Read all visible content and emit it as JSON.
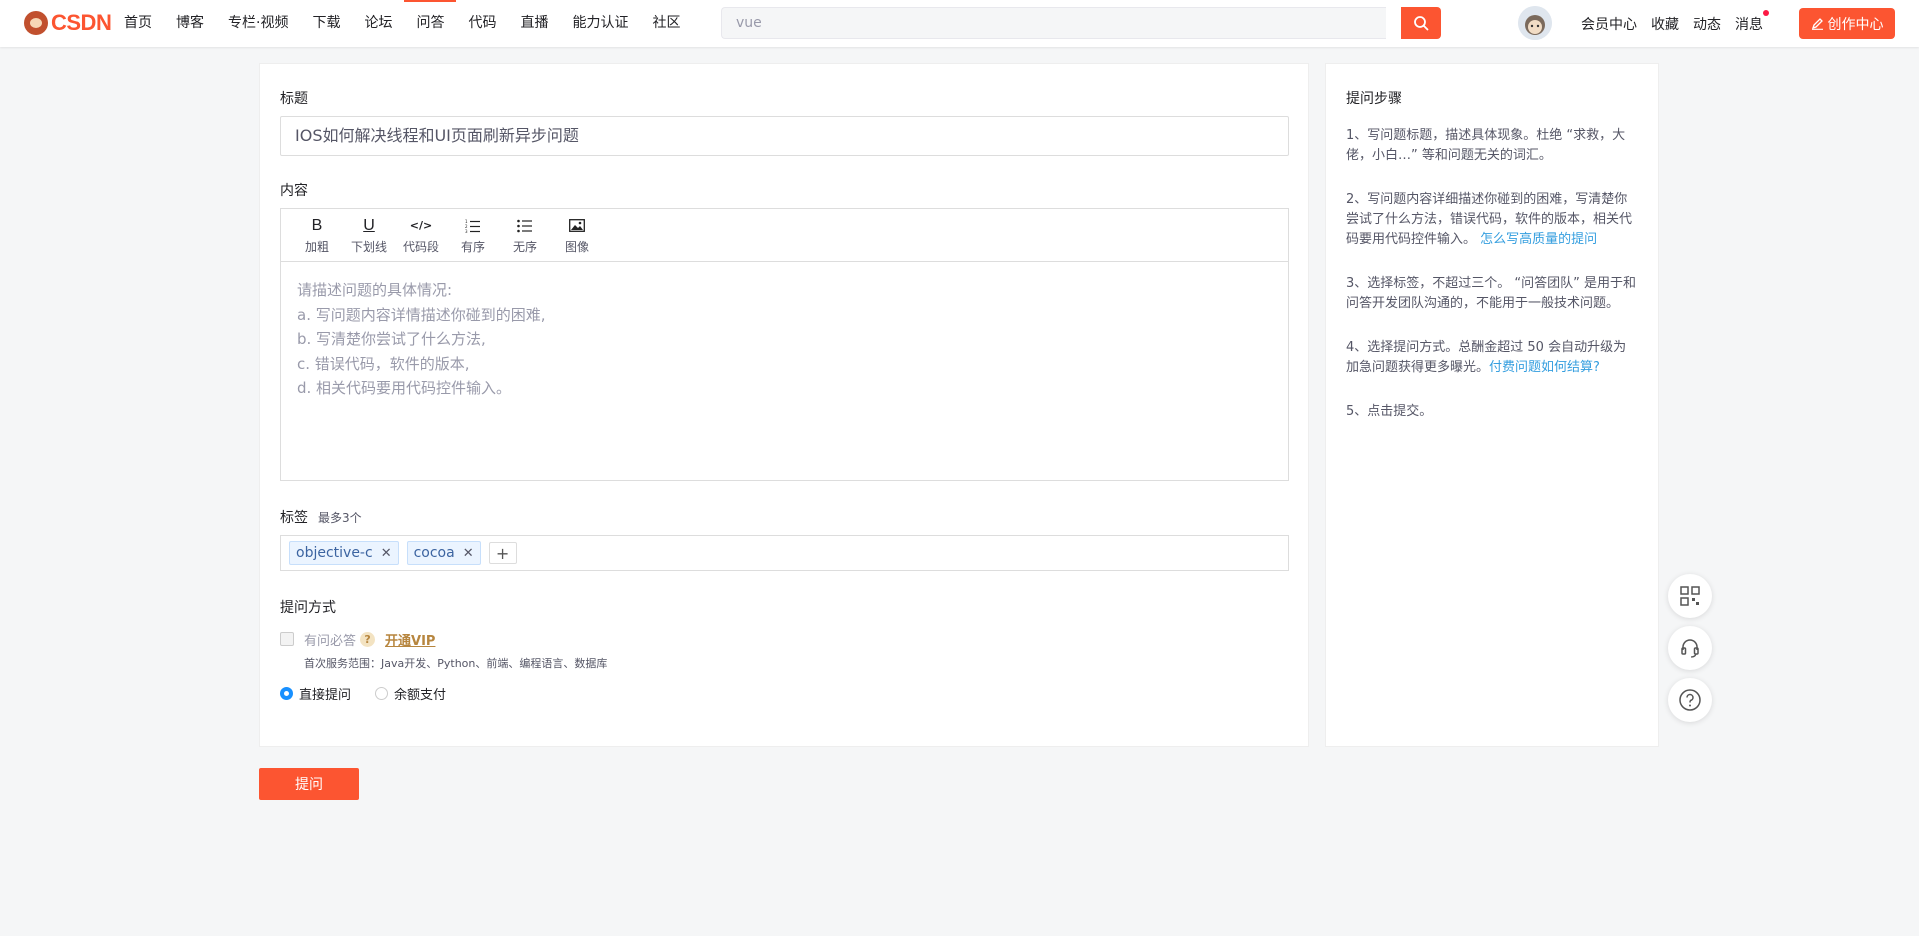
{
  "header": {
    "logo_text": "CSDN",
    "nav": [
      "首页",
      "博客",
      "专栏·视频",
      "下载",
      "论坛",
      "问答",
      "代码",
      "直播",
      "能力认证",
      "社区"
    ],
    "active_nav": "问答",
    "search_placeholder": "vue",
    "right_links": [
      "会员中心",
      "收藏",
      "动态",
      "消息"
    ],
    "create_label": "创作中心",
    "accent": "#fc5531"
  },
  "form": {
    "title_label": "标题",
    "title_value": "IOS如何解决线程和UI页面刷新异步问题",
    "content_label": "内容",
    "toolbar": [
      {
        "icon": "bold-icon",
        "glyph": "B",
        "label": "加粗"
      },
      {
        "icon": "underline-icon",
        "glyph": "U",
        "label": "下划线"
      },
      {
        "icon": "code-icon",
        "glyph": "</>",
        "label": "代码段"
      },
      {
        "icon": "ordered-list-icon",
        "glyph": "",
        "label": "有序"
      },
      {
        "icon": "unordered-list-icon",
        "glyph": "",
        "label": "无序"
      },
      {
        "icon": "image-icon",
        "glyph": "",
        "label": "图像"
      }
    ],
    "content_placeholder": [
      "请描述问题的具体情况:",
      "a. 写问题内容详情描述你碰到的困难,",
      "b. 写清楚你尝试了什么方法,",
      "c. 错误代码，软件的版本,",
      "d. 相关代码要用代码控件输入。"
    ],
    "tags_label": "标签",
    "tags_hint": "最多3个",
    "tags": [
      "objective-c",
      "cocoa"
    ],
    "add_tag_glyph": "+",
    "ask_method_label": "提问方式",
    "vip_option": "有问必答",
    "vip_help_glyph": "?",
    "vip_link": "开通VIP",
    "service_scope": "首次服务范围：Java开发、Python、前端、编程语言、数据库",
    "radios": [
      {
        "label": "直接提问",
        "checked": true
      },
      {
        "label": "余额支付",
        "checked": false
      }
    ],
    "submit_label": "提问"
  },
  "sidebar": {
    "title": "提问步骤",
    "steps": [
      {
        "text": "1、写问题标题，描述具体现象。杜绝 “求救，大佬，小白…” 等和问题无关的词汇。",
        "link": ""
      },
      {
        "text": "2、写问题内容详细描述你碰到的困难，写清楚你尝试了什么方法，错误代码，软件的版本，相关代码要用代码控件输入。 ",
        "link": "怎么写高质量的提问"
      },
      {
        "text": "3、选择标签，不超过三个。 “问答团队” 是用于和问答开发团队沟通的，不能用于一般技术问题。",
        "link": ""
      },
      {
        "text": "4、选择提问方式。总酬金超过 50 会自动升级为加急问题获得更多曝光。",
        "link": "付费问题如何结算?"
      },
      {
        "text": "5、点击提交。",
        "link": ""
      }
    ]
  },
  "float_tools": [
    "qrcode-icon",
    "customer-service-icon",
    "help-icon"
  ]
}
